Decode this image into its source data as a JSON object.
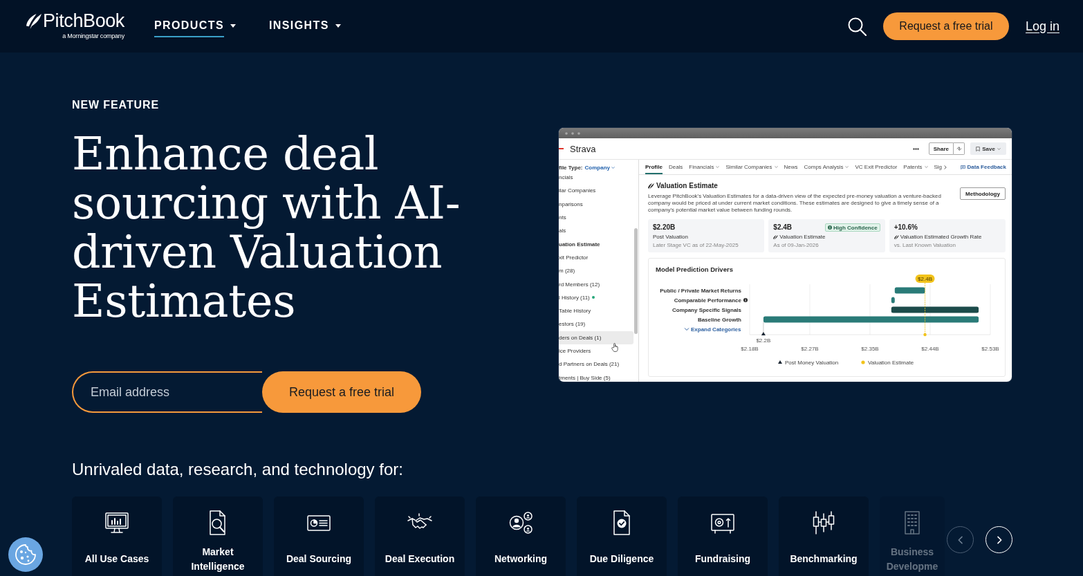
{
  "header": {
    "logo": {
      "wordmark": "PitchBook",
      "tagline": "a Morningstar company"
    },
    "nav": [
      {
        "label": "PRODUCTS",
        "selected": true
      },
      {
        "label": "INSIGHTS",
        "selected": false
      }
    ],
    "cta": "Request a free trial",
    "login": "Log in"
  },
  "hero": {
    "eyebrow": "NEW FEATURE",
    "headline": "Enhance deal sourcing with AI-driven Valuation Estimates",
    "signup": {
      "placeholder": "Email address",
      "button": "Request a free trial"
    }
  },
  "app_window": {
    "company": "Strava",
    "share_button": "Share",
    "save_button": "Save",
    "profile_type": {
      "label": "file Type:",
      "value": "Company"
    },
    "sidebar": [
      {
        "label": "ncials",
        "selected": false,
        "hovered": false,
        "dot": false
      },
      {
        "label": "ilar Companies",
        "selected": false,
        "hovered": false,
        "dot": false
      },
      {
        "label": "nparisons",
        "selected": false,
        "hovered": false,
        "dot": false
      },
      {
        "label": "nts",
        "selected": false,
        "hovered": false,
        "dot": false
      },
      {
        "label": "als",
        "selected": false,
        "hovered": false,
        "dot": false
      },
      {
        "label": "uation Estimate",
        "selected": true,
        "hovered": false,
        "dot": false
      },
      {
        "label": "xit Predictor",
        "selected": false,
        "hovered": false,
        "dot": false
      },
      {
        "label": "m (28)",
        "selected": false,
        "hovered": false,
        "dot": false
      },
      {
        "label": "rd Members (12)",
        "selected": false,
        "hovered": false,
        "dot": false
      },
      {
        "label": "l History (11)",
        "selected": false,
        "hovered": false,
        "dot": true
      },
      {
        "label": "Table History",
        "selected": false,
        "hovered": false,
        "dot": false
      },
      {
        "label": "estors (19)",
        "selected": false,
        "hovered": false,
        "dot": false
      },
      {
        "label": "ders on Deals (1)",
        "selected": false,
        "hovered": true,
        "dot": false
      },
      {
        "label": "ice Providers",
        "selected": false,
        "hovered": false,
        "dot": false
      },
      {
        "label": "d Partners on Deals (21)",
        "selected": false,
        "hovered": false,
        "dot": false
      },
      {
        "label": "tments | Buy Side (5)",
        "selected": false,
        "hovered": false,
        "dot": false
      }
    ],
    "tabs": [
      {
        "label": "Profile",
        "selected": true,
        "dropdown": false
      },
      {
        "label": "Deals",
        "selected": false,
        "dropdown": false
      },
      {
        "label": "Financials",
        "selected": false,
        "dropdown": true
      },
      {
        "label": "Similar Companies",
        "selected": false,
        "dropdown": true
      },
      {
        "label": "News",
        "selected": false,
        "dropdown": false
      },
      {
        "label": "Comps Analysis",
        "selected": false,
        "dropdown": true
      },
      {
        "label": "VC Exit Predictor",
        "selected": false,
        "dropdown": false
      },
      {
        "label": "Patents",
        "selected": false,
        "dropdown": true
      },
      {
        "label": "Sig",
        "selected": false,
        "dropdown": false
      }
    ],
    "feedback_link": "Data Feedback",
    "valuation": {
      "title": "Valuation Estimate",
      "description": "Leverage PitchBook's Valuation Estimates for a data-driven view of the expected pre-money valuation a venture-backed company would be priced at under current market conditions. These estimates are designed to give a timely sense of a company's potential market value between funding rounds.",
      "methodology_button": "Methodology",
      "stats": [
        {
          "value": "$2.20B",
          "label": "Post Valuation",
          "note": "Later Stage VC as of 22-May-2025",
          "estimate_icon": false
        },
        {
          "value": "$2.4B",
          "label": "Valuation Estimate",
          "note": "As of 09-Jan-2026",
          "estimate_icon": true,
          "badge": "High Confidence"
        },
        {
          "value": "+10.6%",
          "label": "Valuation Estimated Growth Rate",
          "note": "vs. Last Known Valuation",
          "estimate_icon": true
        }
      ]
    },
    "drivers": {
      "title": "Model Prediction Drivers",
      "expand_link": "Expand Categories",
      "legend": [
        {
          "kind": "triangle",
          "label": "Post Money Valuation",
          "color": "#1c2733"
        },
        {
          "kind": "dot",
          "label": "Valuation Estimate",
          "color": "#f2c31b"
        }
      ],
      "chart_data": {
        "type": "bar",
        "orientation": "horizontal",
        "categories": [
          "Public / Private Market Returns",
          "Comparable Performance",
          "Company Specific Signals",
          "Baseline Growth"
        ],
        "series": [
          {
            "color": "#2a7b78",
            "values": [
              0.044,
              0.005,
              null,
              0.313
            ],
            "base": [
              2.391,
              2.386,
              null,
              2.2
            ]
          },
          {
            "color": "#1c4b4a",
            "values": [
              null,
              null,
              0.127,
              null
            ],
            "base": [
              null,
              null,
              2.386,
              null
            ]
          }
        ],
        "xlim": [
          2.18,
          2.53
        ],
        "xticks": [
          {
            "value": 2.18,
            "label": "$2.18B"
          },
          {
            "value": 2.2675,
            "label": "$2.27B"
          },
          {
            "value": 2.355,
            "label": "$2.35B"
          },
          {
            "value": 2.4425,
            "label": "$2.44B"
          },
          {
            "value": 2.53,
            "label": "$2.53B"
          }
        ],
        "grid": true,
        "ref_lines": [
          {
            "axis": "x",
            "value": 2.435,
            "label": "$2.4B",
            "color": "#f2c31b"
          }
        ],
        "annotations": [
          "$2.2B"
        ]
      }
    }
  },
  "use_cases": {
    "title": "Unrivaled data, research, and technology for:",
    "cards": [
      {
        "label": "All Use Cases",
        "faded": false
      },
      {
        "label": "Market Intelligence",
        "faded": false
      },
      {
        "label": "Deal Sourcing",
        "faded": false
      },
      {
        "label": "Deal Execution",
        "faded": false
      },
      {
        "label": "Networking",
        "faded": false
      },
      {
        "label": "Due Diligence",
        "faded": false
      },
      {
        "label": "Fundraising",
        "faded": false
      },
      {
        "label": "Benchmarking",
        "faded": false
      },
      {
        "label": "Business Developme",
        "faded": true
      }
    ],
    "prev": {
      "disabled": true
    },
    "next": {
      "disabled": false
    }
  }
}
